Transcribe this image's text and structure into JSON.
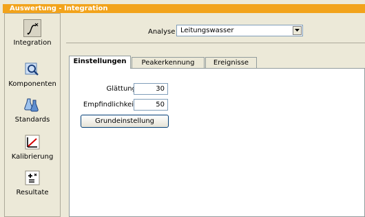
{
  "window": {
    "title": "Auswertung - Integration"
  },
  "sidebar": {
    "items": [
      {
        "label": "Integration",
        "icon": "integration-icon"
      },
      {
        "label": "Komponenten",
        "icon": "komponenten-icon"
      },
      {
        "label": "Standards",
        "icon": "standards-icon"
      },
      {
        "label": "Kalibrierung",
        "icon": "kalibrierung-icon"
      },
      {
        "label": "Resultate",
        "icon": "resultate-icon"
      }
    ]
  },
  "analyse": {
    "label": "Analyse",
    "value": "Leitungswasser"
  },
  "tabs": [
    {
      "label": "Einstellungen"
    },
    {
      "label": "Peakerkennung"
    },
    {
      "label": "Ereignisse"
    }
  ],
  "settings": {
    "smoothing_label": "Glättung",
    "smoothing_value": "30",
    "sensitivity_label": "Empfindlichkeit",
    "sensitivity_value": "50",
    "reset_button": "Grundeinstellung"
  },
  "colors": {
    "titlebar": "#f2a31b",
    "accent": "#d40000"
  }
}
